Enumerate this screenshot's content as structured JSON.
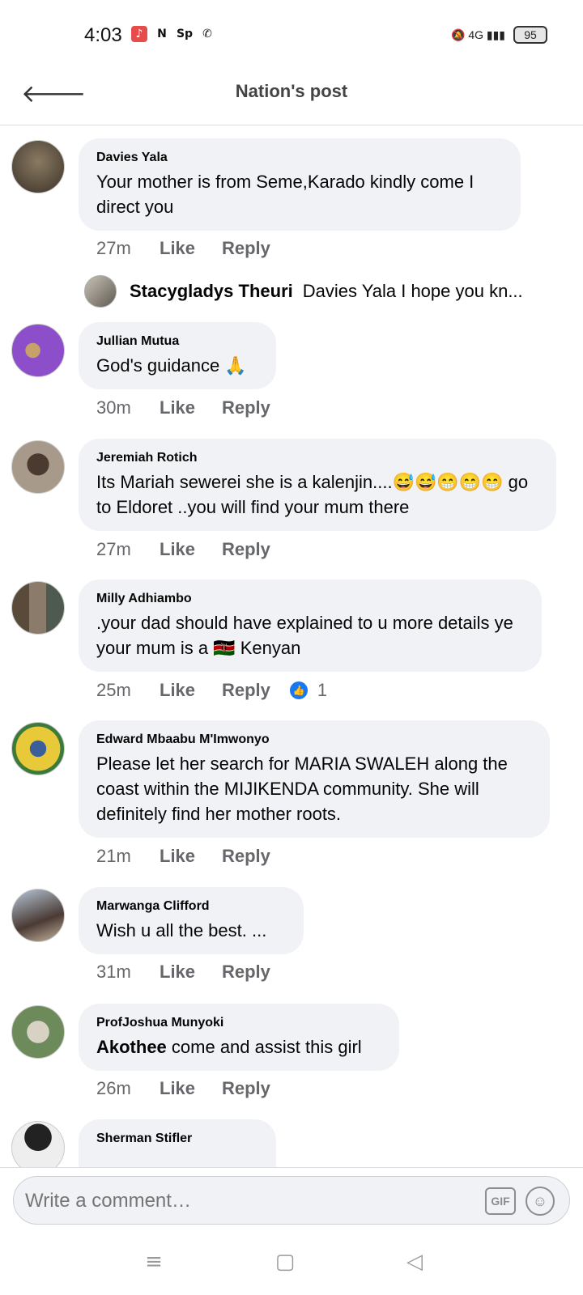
{
  "status_bar": {
    "time": "4:03",
    "app_icons": [
      {
        "icon": "music-app-icon",
        "glyph": "♪"
      },
      {
        "icon": "netflix-icon",
        "glyph": "N"
      },
      {
        "icon": "sp-app-icon",
        "glyph": "Sp"
      },
      {
        "icon": "whatsapp-icon",
        "glyph": "✆"
      }
    ],
    "indicators": "🔕 4G ▮▮▮",
    "battery": "95"
  },
  "header": {
    "back_glyph": "🡐",
    "title": "Nation's post"
  },
  "comments": [
    {
      "author": "Davies Yala",
      "text": "Your mother is from Seme,Karado kindly come I direct you",
      "time": "27m",
      "like": "Like",
      "reply": "Reply",
      "avatar_color": "#5a4a3a"
    },
    {
      "author": "Jullian Mutua",
      "text": "God's guidance 🙏",
      "time": "30m",
      "like": "Like",
      "reply": "Reply",
      "avatar_color": "#8d4fc9"
    },
    {
      "author": "Jeremiah Rotich",
      "text": "Its Mariah sewerei she is a kalenjin....😅😅😁😁😁 go to Eldoret ..you will find your mum there",
      "time": "27m",
      "like": "Like",
      "reply": "Reply",
      "avatar_color": "#7a6b5a"
    },
    {
      "author": "Milly Adhiambo",
      "text": ".your dad should  have explained to u more details ye your mum is a 🇰🇪 Kenyan",
      "time": "25m",
      "like": "Like",
      "reply": "Reply",
      "reactions": "1",
      "avatar_color": "#6b5e50"
    },
    {
      "author": "Edward Mbaabu M'Imwonyo",
      "text": "Please let her search for MARIA SWALEH along the coast within the MIJIKENDA community. She will definitely find her mother roots.",
      "time": "21m",
      "like": "Like",
      "reply": "Reply",
      "avatar_color": "#e8c93a"
    },
    {
      "author": "Marwanga Clifford",
      "text": "Wish  u all the  best. ...",
      "time": "31m",
      "like": "Like",
      "reply": "Reply",
      "avatar_color": "#8aa4c0"
    },
    {
      "author": "ProfJoshua Munyoki",
      "text_bold": "Akothee",
      "text": " come and assist this girl",
      "time": "26m",
      "like": "Like",
      "reply": "Reply",
      "avatar_color": "#6c8a5a"
    },
    {
      "author": "Sherman Stifler",
      "avatar_color": "#222222"
    }
  ],
  "reply_preview": {
    "name": "Stacygladys Theuri",
    "snippet": "Davies Yala I hope you kn..."
  },
  "composer": {
    "placeholder": "Write a comment…",
    "gif_label": "GIF",
    "emoji_glyph": "☺"
  },
  "nav": {
    "menu": "≡",
    "home": "▢",
    "back": "◁"
  }
}
